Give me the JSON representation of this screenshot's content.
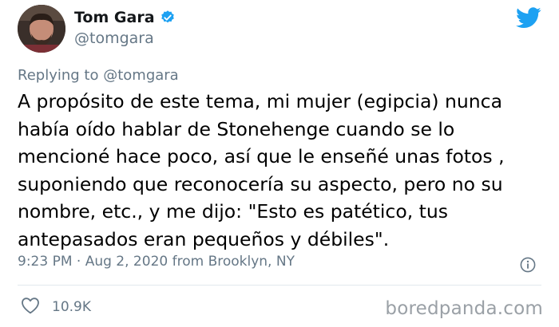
{
  "author": {
    "name": "Tom Gara",
    "handle": "@tomgara",
    "verified": true
  },
  "reply": {
    "prefix": "Replying to",
    "handle": "@tomgara"
  },
  "tweet": {
    "text": "A propósito de este tema, mi mujer (egipcia) nunca\nhabía oído hablar de Stonehenge cuando se lo\nmencioné hace poco, así que le enseñé unas fotos ,\nsuponiendo que reconocería su aspecto, pero no su\nnombre, etc., y me dijo: \"Esto es patético, tus\nantepasados eran pequeños y débiles\".",
    "timestamp": "9:23 PM · Aug 2, 2020 from Brooklyn, NY"
  },
  "actions": {
    "like_count": "10.9K"
  },
  "watermark": "boredpanda.com",
  "icons": {
    "verified": "verified-badge-icon",
    "twitter": "twitter-bird-icon",
    "info": "info-icon",
    "like": "heart-icon"
  },
  "colors": {
    "twitter_blue": "#1da1f2",
    "secondary_text": "#657786",
    "divider": "#e1e8ed"
  }
}
